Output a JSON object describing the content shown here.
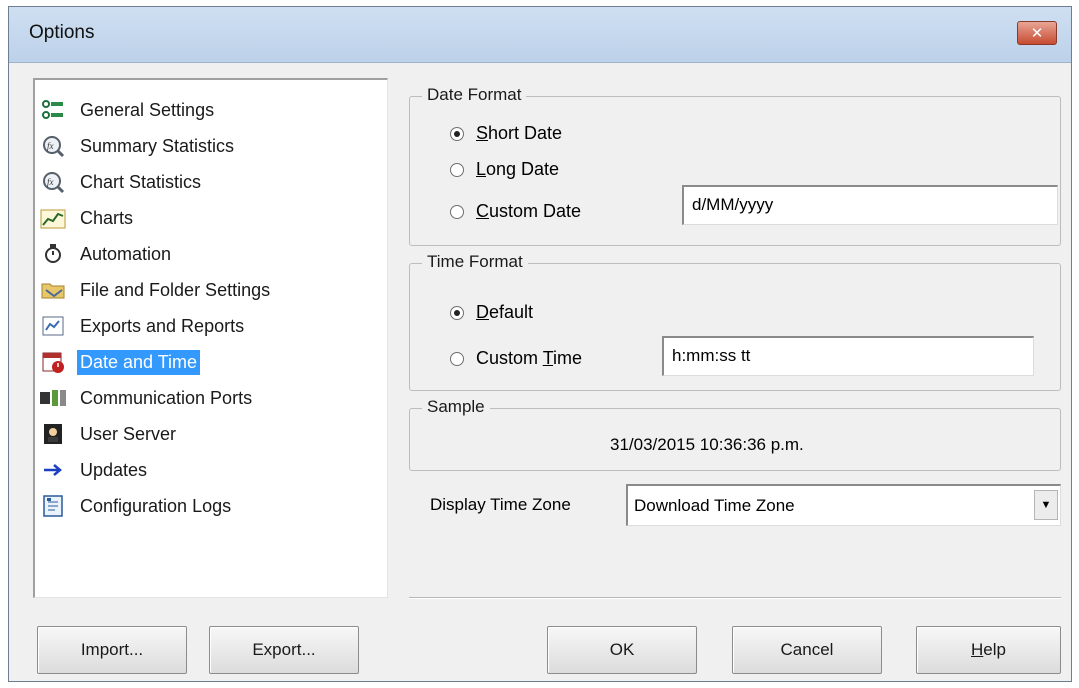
{
  "window": {
    "title": "Options",
    "close_glyph": "✕"
  },
  "categories": [
    {
      "label": "General Settings",
      "icon": "general-settings-icon"
    },
    {
      "label": "Summary Statistics",
      "icon": "summary-statistics-icon"
    },
    {
      "label": "Chart Statistics",
      "icon": "chart-statistics-icon"
    },
    {
      "label": "Charts",
      "icon": "charts-icon"
    },
    {
      "label": "Automation",
      "icon": "automation-icon"
    },
    {
      "label": "File and Folder Settings",
      "icon": "folder-icon"
    },
    {
      "label": "Exports and Reports",
      "icon": "exports-icon"
    },
    {
      "label": "Date and Time",
      "icon": "date-time-icon",
      "selected": true
    },
    {
      "label": "Communication Ports",
      "icon": "communication-ports-icon"
    },
    {
      "label": "User Server",
      "icon": "user-server-icon"
    },
    {
      "label": "Updates",
      "icon": "updates-arrow-icon"
    },
    {
      "label": "Configuration Logs",
      "icon": "configuration-logs-icon"
    }
  ],
  "date_format": {
    "legend": "Date Format",
    "short_date": {
      "mnemonic": "S",
      "rest": "hort Date",
      "checked": true
    },
    "long_date": {
      "mnemonic": "L",
      "rest": "ong Date",
      "checked": false
    },
    "custom_date": {
      "mnemonic": "C",
      "rest": "ustom Date",
      "checked": false
    },
    "custom_date_value": "d/MM/yyyy"
  },
  "time_format": {
    "legend": "Time Format",
    "default": {
      "mnemonic": "D",
      "rest": "efault",
      "checked": true
    },
    "custom_time": {
      "prefix": "Custom ",
      "mnemonic": "T",
      "rest": "ime",
      "checked": false
    },
    "custom_time_value": "h:mm:ss tt"
  },
  "sample": {
    "legend": "Sample",
    "value": "31/03/2015 10:36:36 p.m."
  },
  "time_zone": {
    "label": "Display Time Zone",
    "value": "Download Time Zone"
  },
  "buttons": {
    "import": "Import...",
    "export": "Export...",
    "ok": "OK",
    "cancel": "Cancel",
    "help_mnemonic": "H",
    "help_rest": "elp"
  }
}
